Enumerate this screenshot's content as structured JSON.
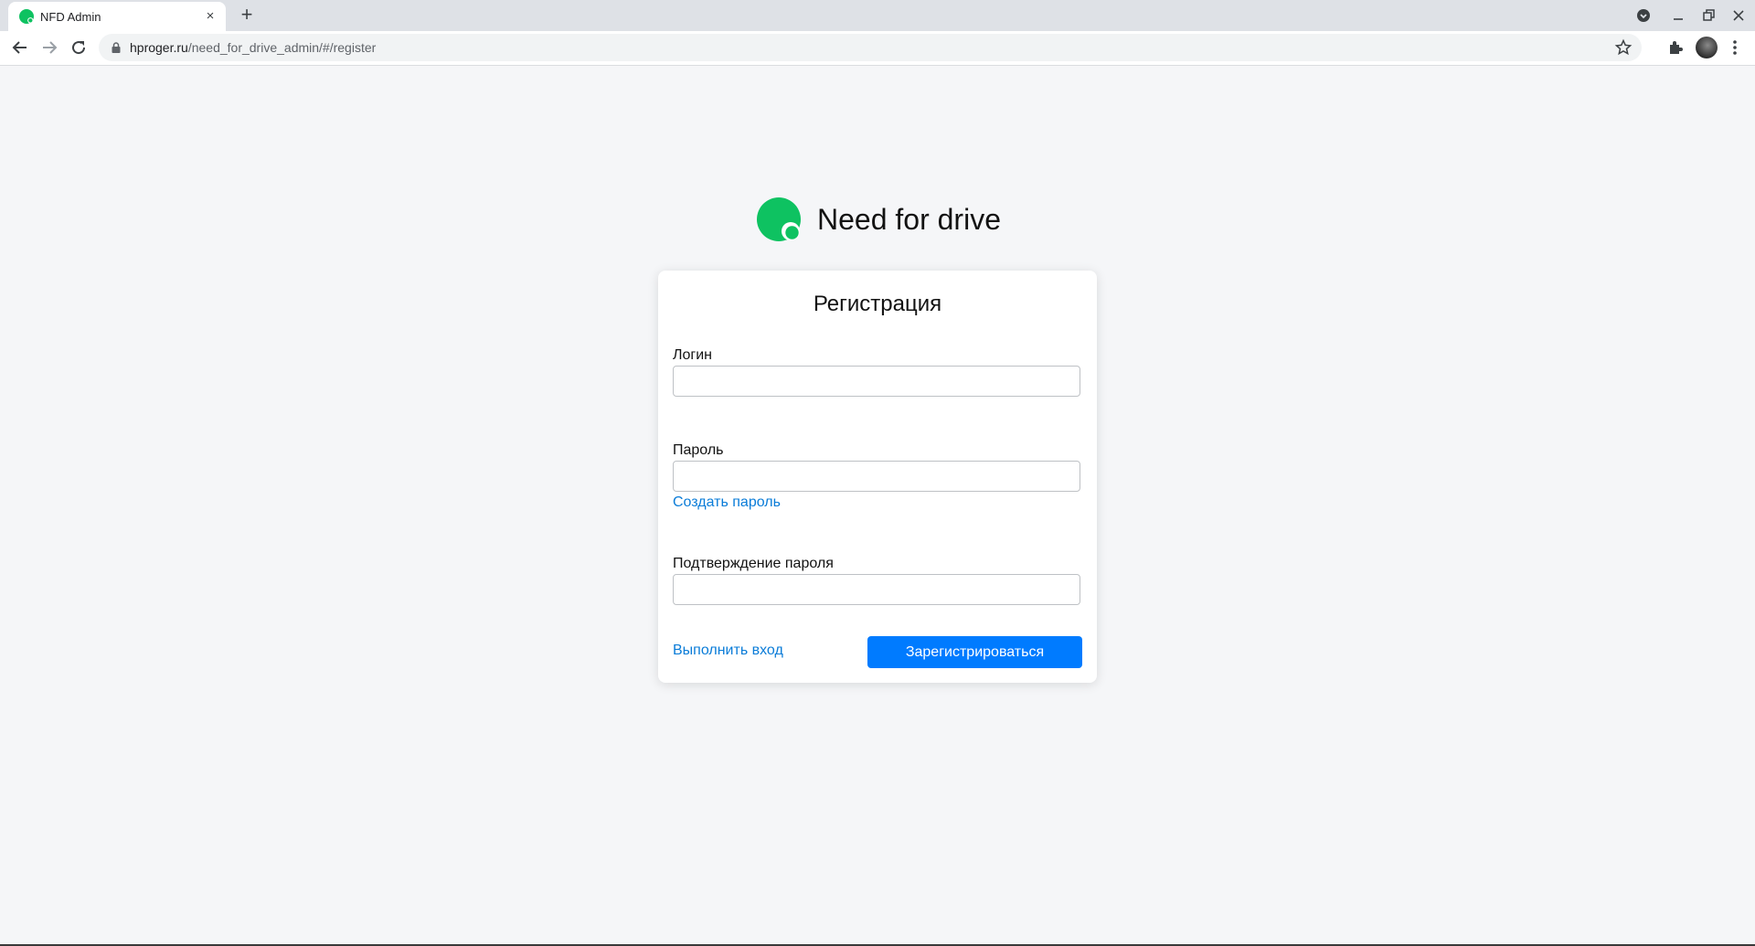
{
  "browser": {
    "tab_title": "NFD Admin",
    "tab_close": "×",
    "new_tab": "+",
    "url_host": "hproger.ru",
    "url_path": "/need_for_drive_admin/#/register"
  },
  "brand": {
    "name": "Need for drive",
    "logo_color": "#0ec261"
  },
  "form": {
    "title": "Регистрация",
    "login_label": "Логин",
    "login_value": "",
    "password_label": "Пароль",
    "password_value": "",
    "create_password_link": "Создать пароль",
    "confirm_label": "Подтверждение пароля",
    "confirm_value": "",
    "login_link": "Выполнить вход",
    "submit_label": "Зарегистрироваться"
  },
  "colors": {
    "accent": "#007bff",
    "link": "#0a7cd8",
    "background": "#f5f6f8"
  },
  "icons": [
    "favicon-icon",
    "close-icon",
    "plus-icon",
    "back-icon",
    "forward-icon",
    "reload-icon",
    "lock-icon",
    "star-icon",
    "extensions-icon",
    "more-icon"
  ]
}
